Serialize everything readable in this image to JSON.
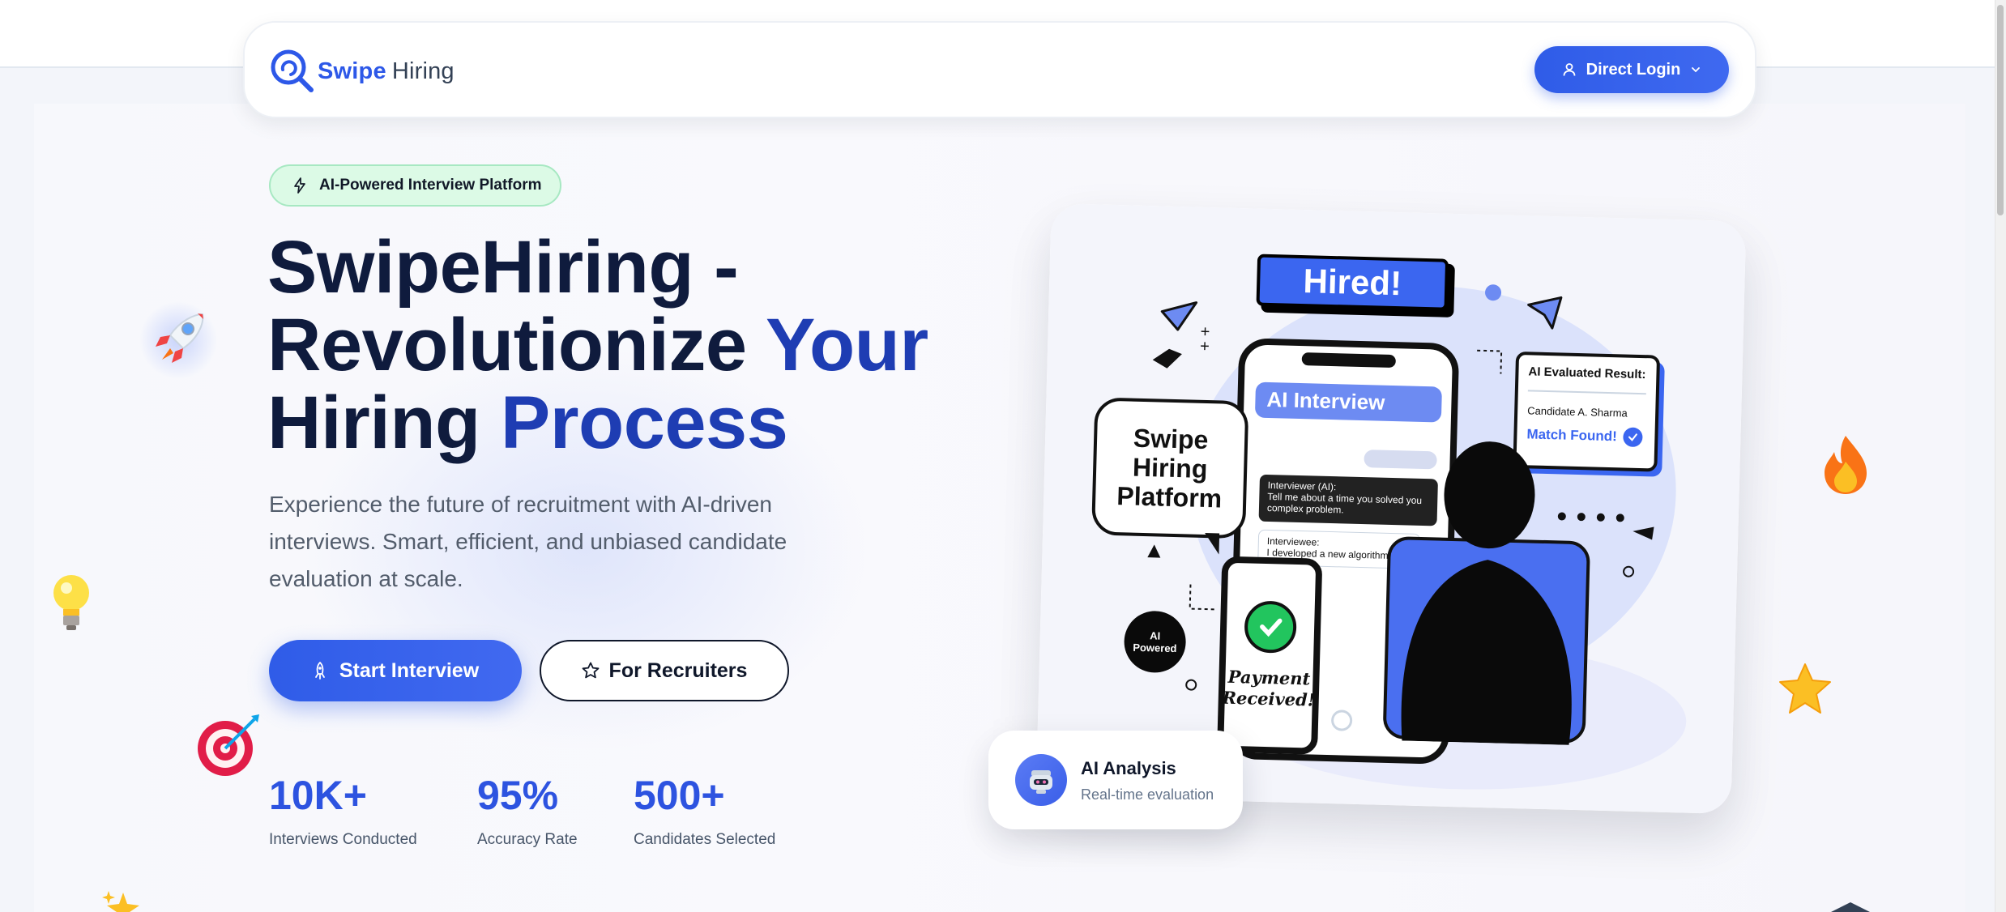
{
  "nav": {
    "brand_primary": "Swipe",
    "brand_secondary": "Hiring",
    "login_label": "Direct Login"
  },
  "hero": {
    "badge": "AI-Powered Interview Platform",
    "headline_line1": "SwipeHiring -",
    "headline_line2_a": "Revolutionize",
    "headline_line2_b": "Your",
    "headline_line3_a": "Hiring",
    "headline_line3_b": "Process",
    "subtitle": "Experience the future of recruitment with AI-driven interviews. Smart, efficient, and unbiased candidate evaluation at scale.",
    "primary_cta": "Start Interview",
    "secondary_cta": "For Recruiters"
  },
  "stats": [
    {
      "value": "10K+",
      "label": "Interviews Conducted"
    },
    {
      "value": "95%",
      "label": "Accuracy Rate"
    },
    {
      "value": "500+",
      "label": "Candidates Selected"
    }
  ],
  "illustration": {
    "hired": "Hired!",
    "phone_header": "AI Interview",
    "bubble_line1": "Swipe",
    "bubble_line2": "Hiring",
    "bubble_line3": "Platform",
    "chat_interviewer_label": "Interviewer (AI):",
    "chat_interviewer_text_1": "Tell me about a time you solved you",
    "chat_interviewer_text_2": "complex problem.",
    "chat_interviewee_label": "Interviewee:",
    "chat_interviewee_text": "I developed a new algorithm...",
    "result_title": "AI Evaluated Result:",
    "result_candidate": "Candidate A. Sharma",
    "result_match": "Match Found!",
    "ai_badge_1": "AI",
    "ai_badge_2": "Powered",
    "payment_1": "Payment",
    "payment_2": "Received!"
  },
  "analysis": {
    "title": "AI Analysis",
    "subtitle": "Real-time evaluation"
  },
  "colors": {
    "primary": "#2f5ce8",
    "headline": "#0f1b3d",
    "headline_accent": "#1e3db3",
    "badge_bg": "#dcfae6"
  },
  "icons": {
    "logo": "magnifier-logo-icon",
    "login": "user-icon",
    "dropdown": "chevron-down-icon",
    "badge": "lightning-icon",
    "start": "rocket-icon",
    "recruiters": "star-outline-icon",
    "analysis": "robot-icon"
  }
}
